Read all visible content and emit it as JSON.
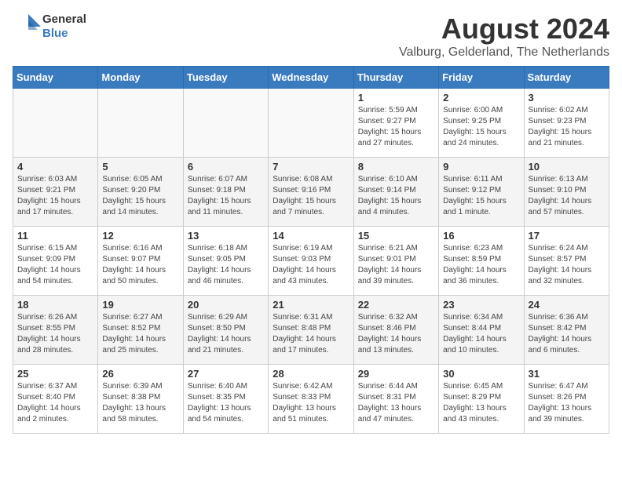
{
  "logo": {
    "line1": "General",
    "line2": "Blue"
  },
  "title": "August 2024",
  "subtitle": "Valburg, Gelderland, The Netherlands",
  "days_of_week": [
    "Sunday",
    "Monday",
    "Tuesday",
    "Wednesday",
    "Thursday",
    "Friday",
    "Saturday"
  ],
  "weeks": [
    [
      {
        "day": "",
        "info": ""
      },
      {
        "day": "",
        "info": ""
      },
      {
        "day": "",
        "info": ""
      },
      {
        "day": "",
        "info": ""
      },
      {
        "day": "1",
        "info": "Sunrise: 5:59 AM\nSunset: 9:27 PM\nDaylight: 15 hours and 27 minutes."
      },
      {
        "day": "2",
        "info": "Sunrise: 6:00 AM\nSunset: 9:25 PM\nDaylight: 15 hours and 24 minutes."
      },
      {
        "day": "3",
        "info": "Sunrise: 6:02 AM\nSunset: 9:23 PM\nDaylight: 15 hours and 21 minutes."
      }
    ],
    [
      {
        "day": "4",
        "info": "Sunrise: 6:03 AM\nSunset: 9:21 PM\nDaylight: 15 hours and 17 minutes."
      },
      {
        "day": "5",
        "info": "Sunrise: 6:05 AM\nSunset: 9:20 PM\nDaylight: 15 hours and 14 minutes."
      },
      {
        "day": "6",
        "info": "Sunrise: 6:07 AM\nSunset: 9:18 PM\nDaylight: 15 hours and 11 minutes."
      },
      {
        "day": "7",
        "info": "Sunrise: 6:08 AM\nSunset: 9:16 PM\nDaylight: 15 hours and 7 minutes."
      },
      {
        "day": "8",
        "info": "Sunrise: 6:10 AM\nSunset: 9:14 PM\nDaylight: 15 hours and 4 minutes."
      },
      {
        "day": "9",
        "info": "Sunrise: 6:11 AM\nSunset: 9:12 PM\nDaylight: 15 hours and 1 minute."
      },
      {
        "day": "10",
        "info": "Sunrise: 6:13 AM\nSunset: 9:10 PM\nDaylight: 14 hours and 57 minutes."
      }
    ],
    [
      {
        "day": "11",
        "info": "Sunrise: 6:15 AM\nSunset: 9:09 PM\nDaylight: 14 hours and 54 minutes."
      },
      {
        "day": "12",
        "info": "Sunrise: 6:16 AM\nSunset: 9:07 PM\nDaylight: 14 hours and 50 minutes."
      },
      {
        "day": "13",
        "info": "Sunrise: 6:18 AM\nSunset: 9:05 PM\nDaylight: 14 hours and 46 minutes."
      },
      {
        "day": "14",
        "info": "Sunrise: 6:19 AM\nSunset: 9:03 PM\nDaylight: 14 hours and 43 minutes."
      },
      {
        "day": "15",
        "info": "Sunrise: 6:21 AM\nSunset: 9:01 PM\nDaylight: 14 hours and 39 minutes."
      },
      {
        "day": "16",
        "info": "Sunrise: 6:23 AM\nSunset: 8:59 PM\nDaylight: 14 hours and 36 minutes."
      },
      {
        "day": "17",
        "info": "Sunrise: 6:24 AM\nSunset: 8:57 PM\nDaylight: 14 hours and 32 minutes."
      }
    ],
    [
      {
        "day": "18",
        "info": "Sunrise: 6:26 AM\nSunset: 8:55 PM\nDaylight: 14 hours and 28 minutes."
      },
      {
        "day": "19",
        "info": "Sunrise: 6:27 AM\nSunset: 8:52 PM\nDaylight: 14 hours and 25 minutes."
      },
      {
        "day": "20",
        "info": "Sunrise: 6:29 AM\nSunset: 8:50 PM\nDaylight: 14 hours and 21 minutes."
      },
      {
        "day": "21",
        "info": "Sunrise: 6:31 AM\nSunset: 8:48 PM\nDaylight: 14 hours and 17 minutes."
      },
      {
        "day": "22",
        "info": "Sunrise: 6:32 AM\nSunset: 8:46 PM\nDaylight: 14 hours and 13 minutes."
      },
      {
        "day": "23",
        "info": "Sunrise: 6:34 AM\nSunset: 8:44 PM\nDaylight: 14 hours and 10 minutes."
      },
      {
        "day": "24",
        "info": "Sunrise: 6:36 AM\nSunset: 8:42 PM\nDaylight: 14 hours and 6 minutes."
      }
    ],
    [
      {
        "day": "25",
        "info": "Sunrise: 6:37 AM\nSunset: 8:40 PM\nDaylight: 14 hours and 2 minutes."
      },
      {
        "day": "26",
        "info": "Sunrise: 6:39 AM\nSunset: 8:38 PM\nDaylight: 13 hours and 58 minutes."
      },
      {
        "day": "27",
        "info": "Sunrise: 6:40 AM\nSunset: 8:35 PM\nDaylight: 13 hours and 54 minutes."
      },
      {
        "day": "28",
        "info": "Sunrise: 6:42 AM\nSunset: 8:33 PM\nDaylight: 13 hours and 51 minutes."
      },
      {
        "day": "29",
        "info": "Sunrise: 6:44 AM\nSunset: 8:31 PM\nDaylight: 13 hours and 47 minutes."
      },
      {
        "day": "30",
        "info": "Sunrise: 6:45 AM\nSunset: 8:29 PM\nDaylight: 13 hours and 43 minutes."
      },
      {
        "day": "31",
        "info": "Sunrise: 6:47 AM\nSunset: 8:26 PM\nDaylight: 13 hours and 39 minutes."
      }
    ]
  ]
}
